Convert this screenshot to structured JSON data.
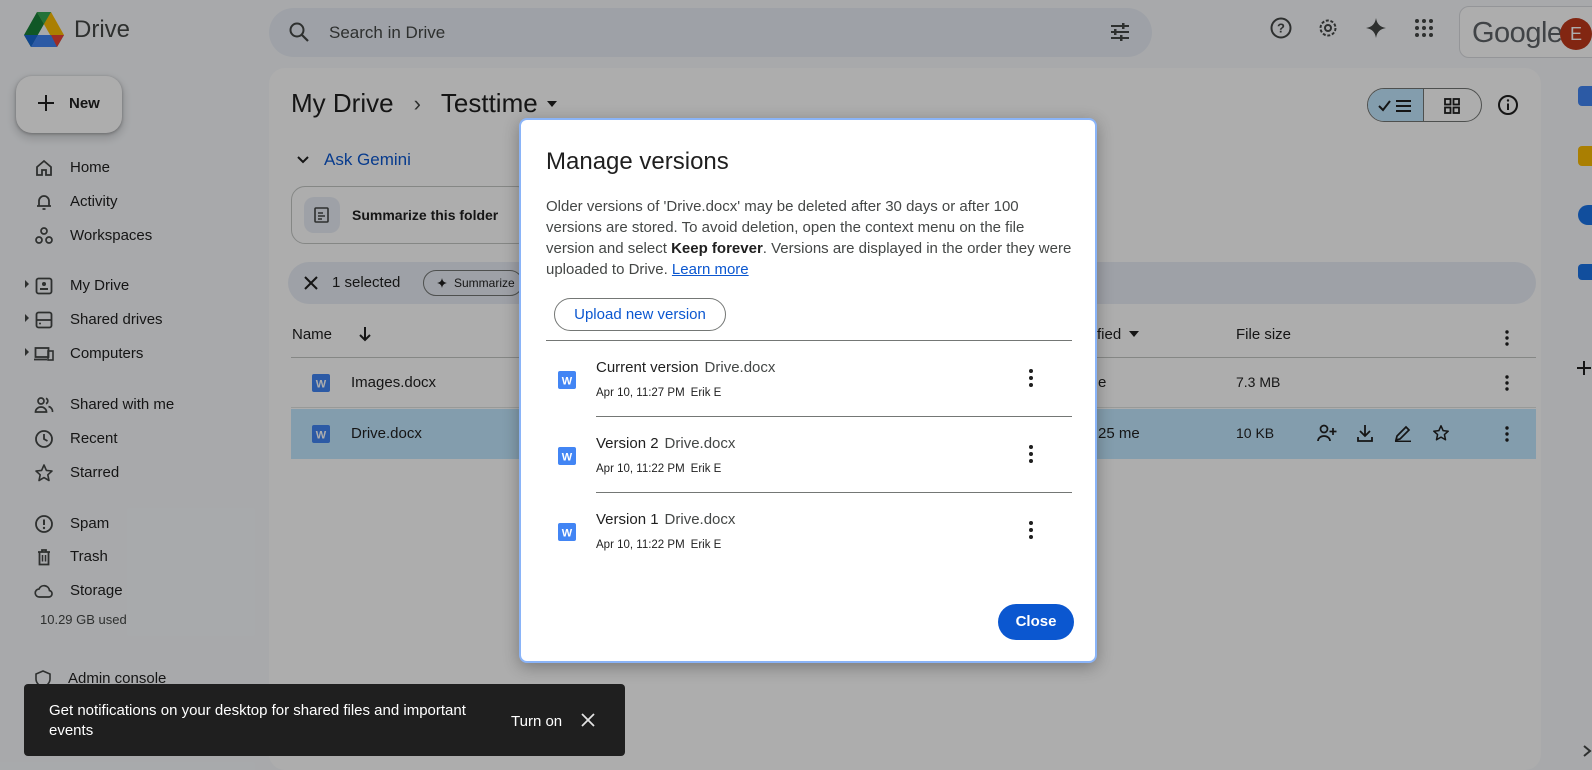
{
  "app": {
    "name": "Drive"
  },
  "search": {
    "placeholder": "Search in Drive"
  },
  "header_icons": [
    "help-icon",
    "settings-icon",
    "gemini-sparkle-icon",
    "apps-grid-icon"
  ],
  "account": {
    "brand": "Google",
    "avatar_letter": "E",
    "avatar_color": "#c0391b"
  },
  "sidebar": {
    "new_label": "New",
    "items": [
      {
        "label": "Home",
        "icon": "home-icon"
      },
      {
        "label": "Activity",
        "icon": "bell-icon"
      },
      {
        "label": "Workspaces",
        "icon": "workspaces-icon"
      },
      {
        "label": "My Drive",
        "icon": "my-drive-icon"
      },
      {
        "label": "Shared drives",
        "icon": "shared-drives-icon"
      },
      {
        "label": "Computers",
        "icon": "computers-icon"
      },
      {
        "label": "Shared with me",
        "icon": "people-icon"
      },
      {
        "label": "Recent",
        "icon": "clock-icon"
      },
      {
        "label": "Starred",
        "icon": "star-icon"
      },
      {
        "label": "Spam",
        "icon": "spam-icon"
      },
      {
        "label": "Trash",
        "icon": "trash-icon"
      },
      {
        "label": "Storage",
        "icon": "cloud-icon"
      }
    ],
    "storage_used": "10.29 GB used",
    "admin_console": "Admin console"
  },
  "breadcrumb": {
    "root": "My Drive",
    "current": "Testtime"
  },
  "gemini": {
    "ask_label": "Ask Gemini",
    "summarize_folder": "Summarize this folder"
  },
  "selection": {
    "count_label": "1 selected",
    "summarize_chip": "Summarize"
  },
  "table": {
    "col_name": "Name",
    "col_modified_partial": "fied",
    "col_size": "File size",
    "rows": [
      {
        "name": "Images.docx",
        "modified_partial": "e",
        "size": "7.3 MB",
        "selected": false
      },
      {
        "name": "Drive.docx",
        "modified_partial": "25 me",
        "size": "10 KB",
        "selected": true
      }
    ]
  },
  "dialog": {
    "title": "Manage versions",
    "desc_part1": "Older versions of 'Drive.docx' may be deleted after 30 days or after 100 versions are stored. To avoid deletion, open the context menu on the file version and select ",
    "desc_bold": "Keep forever",
    "desc_part2": ". Versions are displayed in the order they were uploaded to Drive. ",
    "learn_more": "Learn more",
    "upload_label": "Upload new version",
    "versions": [
      {
        "label": "Current version",
        "file": "Drive.docx",
        "date": "Apr 10, 11:27 PM",
        "author": "Erik E"
      },
      {
        "label": "Version 2",
        "file": "Drive.docx",
        "date": "Apr 10, 11:22 PM",
        "author": "Erik E"
      },
      {
        "label": "Version 1",
        "file": "Drive.docx",
        "date": "Apr 10, 11:22 PM",
        "author": "Erik E"
      }
    ],
    "close_label": "Close"
  },
  "snackbar": {
    "message": "Get notifications on your desktop for shared files and important events",
    "action": "Turn on"
  },
  "colors": {
    "accent": "#0b57d0",
    "selected_row": "#c2e7ff",
    "scrim": "rgba(0,0,0,0.32)"
  }
}
